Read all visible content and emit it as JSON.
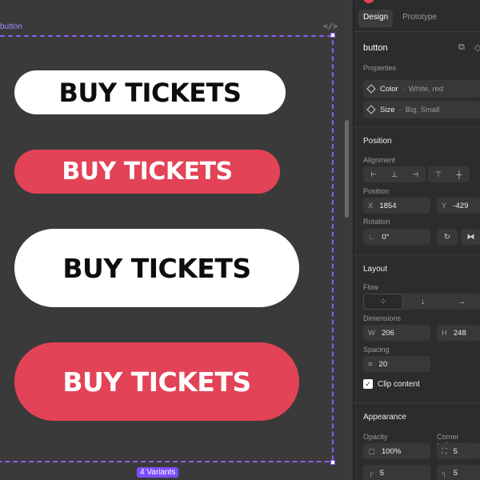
{
  "canvas": {
    "frame_label": "button",
    "code_icon": "</>",
    "buttons": [
      {
        "label": "BUY TICKETS",
        "variant": "white-small"
      },
      {
        "label": "BUY TICKETS",
        "variant": "red-small"
      },
      {
        "label": "BUY TICKETS",
        "variant": "white-big"
      },
      {
        "label": "BUY TICKETS",
        "variant": "red-big"
      }
    ],
    "variants_badge": "4 Variants"
  },
  "panel": {
    "tabs": [
      "Design",
      "Prototype"
    ],
    "component_name": "button",
    "properties_label": "Properties",
    "properties": [
      {
        "name": "Color",
        "values": "White, red"
      },
      {
        "name": "Size",
        "values": "Big, Small"
      }
    ],
    "position_section": "Position",
    "alignment_label": "Alignment",
    "position_label": "Position",
    "x_label": "X",
    "x_value": "1854",
    "y_label": "Y",
    "y_value": "-429",
    "rotation_label": "Rotation",
    "rotation_value": "0°",
    "layout_section": "Layout",
    "flow_label": "Flow",
    "dimensions_label": "Dimensions",
    "w_label": "W",
    "w_value": "206",
    "h_label": "H",
    "h_value": "248",
    "spacing_label": "Spacing",
    "spacing_value": "20",
    "clip_content_label": "Clip content",
    "appearance_section": "Appearance",
    "opacity_label": "Opacity",
    "opacity_value": "100%",
    "corner_radius_label": "Corner radius",
    "corner_values": [
      "5",
      "5",
      "5"
    ]
  },
  "colors": {
    "accent": "#8a5cf6",
    "brand_red": "#e34357",
    "panel_bg": "#2c2c2c",
    "canvas_bg": "#3a3a3a"
  }
}
